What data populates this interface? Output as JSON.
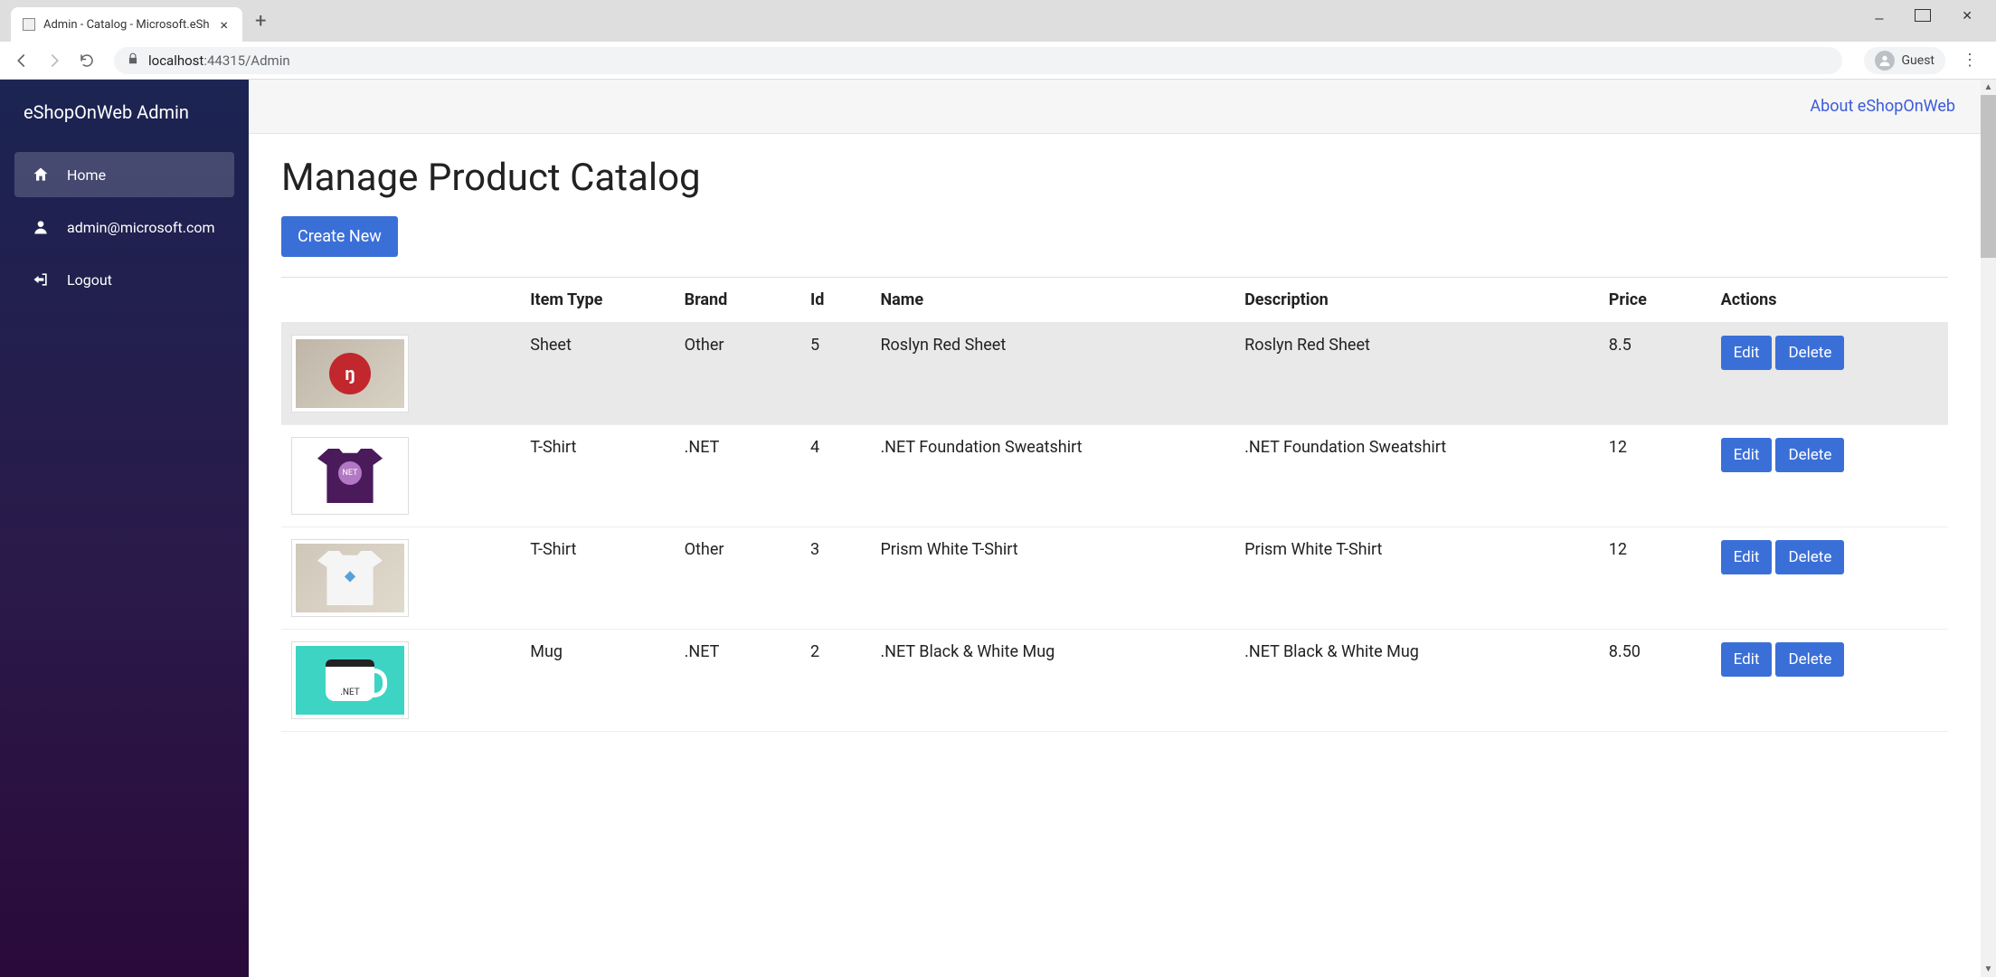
{
  "browser": {
    "tab_title": "Admin - Catalog - Microsoft.eSh",
    "url_host": "localhost",
    "url_port_path": ":44315/Admin",
    "guest_label": "Guest"
  },
  "sidebar": {
    "brand": "eShopOnWeb Admin",
    "items": [
      {
        "label": "Home",
        "icon": "home"
      },
      {
        "label": "admin@microsoft.com",
        "icon": "user"
      },
      {
        "label": "Logout",
        "icon": "logout"
      }
    ]
  },
  "topbar": {
    "about_label": "About eShopOnWeb"
  },
  "page": {
    "title": "Manage Product Catalog",
    "create_label": "Create New"
  },
  "table": {
    "headers": {
      "item_type": "Item Type",
      "brand": "Brand",
      "id": "Id",
      "name": "Name",
      "description": "Description",
      "price": "Price",
      "actions": "Actions"
    },
    "action_labels": {
      "edit": "Edit",
      "delete": "Delete"
    },
    "rows": [
      {
        "thumb": "roslyn",
        "item_type": "Sheet",
        "brand": "Other",
        "id": "5",
        "name": "Roslyn Red Sheet",
        "description": "Roslyn Red Sheet",
        "price": "8.5",
        "hovered": true
      },
      {
        "thumb": "tee-purple",
        "item_type": "T-Shirt",
        "brand": ".NET",
        "id": "4",
        "name": ".NET Foundation Sweatshirt",
        "description": ".NET Foundation Sweatshirt",
        "price": "12",
        "hovered": false
      },
      {
        "thumb": "tee-white",
        "item_type": "T-Shirt",
        "brand": "Other",
        "id": "3",
        "name": "Prism White T-Shirt",
        "description": "Prism White T-Shirt",
        "price": "12",
        "hovered": false
      },
      {
        "thumb": "mug",
        "item_type": "Mug",
        "brand": ".NET",
        "id": "2",
        "name": ".NET Black & White Mug",
        "description": ".NET Black & White Mug",
        "price": "8.50",
        "hovered": false
      }
    ]
  }
}
